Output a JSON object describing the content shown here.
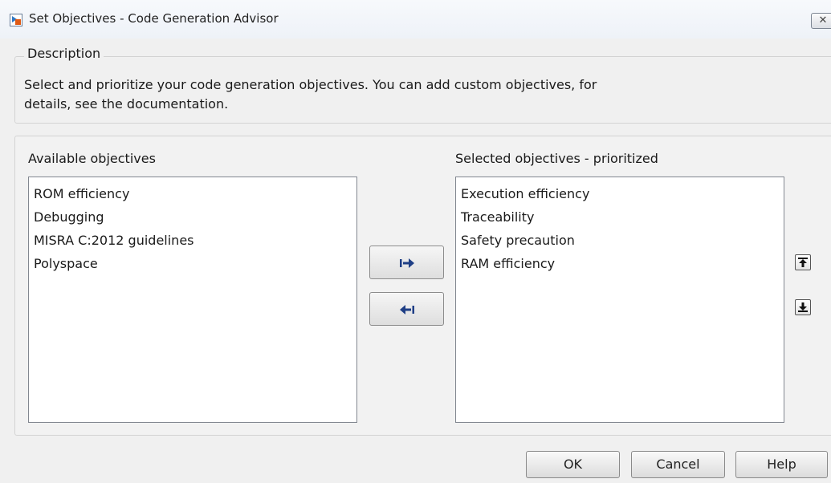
{
  "window": {
    "title": "Set Objectives - Code Generation Advisor",
    "app_icon": "simulink-model-icon",
    "close_icon": "close-icon"
  },
  "description": {
    "legend": "Description",
    "text": "Select and prioritize your code generation objectives. You can add custom objectives, for details, see the documentation."
  },
  "available": {
    "label": "Available objectives",
    "items": [
      "ROM efficiency",
      "Debugging",
      "MISRA C:2012 guidelines",
      "Polyspace"
    ]
  },
  "selected": {
    "label": "Selected objectives - prioritized",
    "items": [
      "Execution efficiency",
      "Traceability",
      "Safety precaution",
      "RAM efficiency"
    ]
  },
  "move_buttons": {
    "add_icon": "arrow-right-icon",
    "remove_icon": "arrow-left-icon"
  },
  "priority_buttons": {
    "up_icon": "move-up-icon",
    "down_icon": "move-down-icon"
  },
  "footer": {
    "ok_label": "OK",
    "cancel_label": "Cancel",
    "help_label": "Help"
  }
}
